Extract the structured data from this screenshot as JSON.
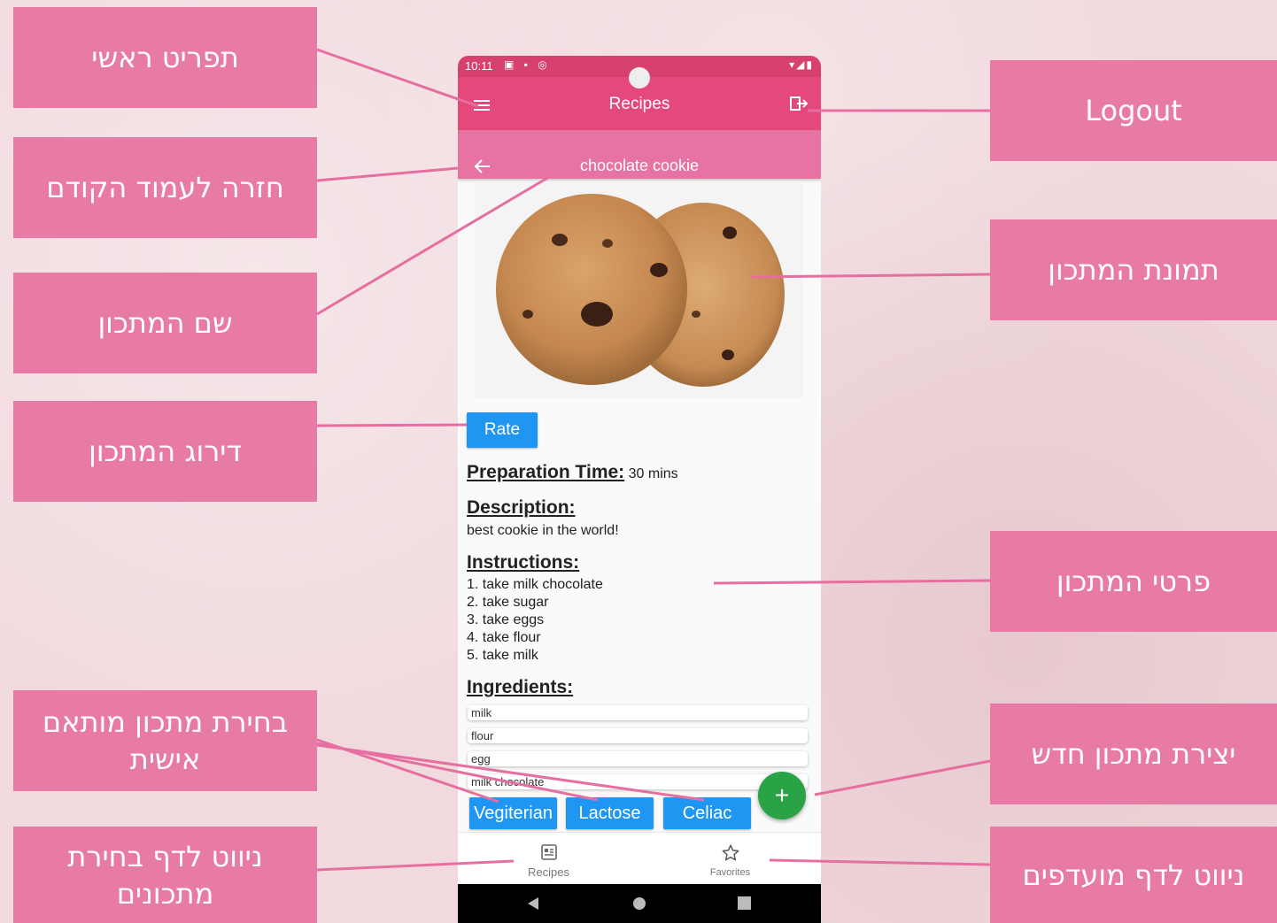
{
  "callouts": {
    "main_menu": "תפריט ראשי",
    "back": "חזרה לעמוד הקודם",
    "recipe_name": "שם המתכון",
    "rating": "דירוג המתכון",
    "diet_filter": "בחירת מתכון מותאם אישית",
    "nav_recipes": "ניווט לדף בחירת מתכונים",
    "logout": "Logout",
    "recipe_image": "תמונת המתכון",
    "recipe_details": "פרטי המתכון",
    "create_recipe": "יצירת מתכון חדש",
    "nav_favorites": "ניווט לדף מועדפים"
  },
  "status_bar": {
    "time": "10:11"
  },
  "app_bar": {
    "title": "Recipes"
  },
  "recipe": {
    "name": "chocolate cookie",
    "rate_label": "Rate",
    "prep_label": "Preparation Time:",
    "prep_value": "30 mins",
    "description_label": "Description:",
    "description": "best cookie in the world!",
    "instructions_label": "Instructions:",
    "instructions": [
      "1. take milk chocolate",
      "2. take sugar",
      "3. take eggs",
      "4. take flour",
      "5. take milk"
    ],
    "ingredients_label": "Ingredients:",
    "ingredients": [
      "milk",
      "flour",
      "egg",
      "milk chocolate"
    ]
  },
  "diet_buttons": [
    "Vegiterian",
    "Lactose",
    "Celiac"
  ],
  "fab_icon": "plus-icon",
  "bottom_nav": {
    "recipes": "Recipes",
    "favorites": "Favorites"
  },
  "colors": {
    "callout": "#e87aa6",
    "status_bar": "#d6416e",
    "app_bar": "#e5487a",
    "sub_bar": "#e673a1",
    "button_blue": "#1f96f2",
    "fab_green": "#2aa346",
    "leader_line": "#e66ea1"
  }
}
